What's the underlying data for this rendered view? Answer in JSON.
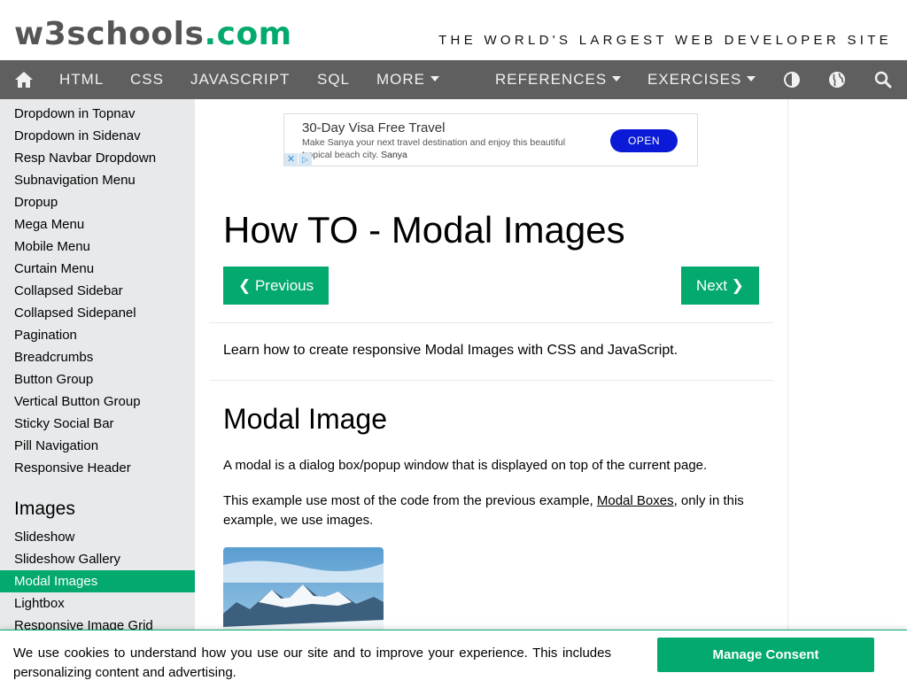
{
  "header": {
    "logo_main": "w3schools",
    "logo_suffix": ".com",
    "slogan": "THE WORLD'S LARGEST WEB DEVELOPER SITE"
  },
  "nav": {
    "items": [
      "HTML",
      "CSS",
      "JAVASCRIPT",
      "SQL",
      "MORE",
      "REFERENCES",
      "EXERCISES"
    ],
    "icons": [
      "home-icon",
      "contrast-icon",
      "globe-icon",
      "search-icon"
    ]
  },
  "sidebar": {
    "links": [
      "Dropdown in Topnav",
      "Dropdown in Sidenav",
      "Resp Navbar Dropdown",
      "Subnavigation Menu",
      "Dropup",
      "Mega Menu",
      "Mobile Menu",
      "Curtain Menu",
      "Collapsed Sidebar",
      "Collapsed Sidepanel",
      "Pagination",
      "Breadcrumbs",
      "Button Group",
      "Vertical Button Group",
      "Sticky Social Bar",
      "Pill Navigation",
      "Responsive Header"
    ],
    "images_heading": "Images",
    "image_links": [
      "Slideshow",
      "Slideshow Gallery",
      "Modal Images",
      "Lightbox",
      "Responsive Image Grid"
    ],
    "active_link": "Modal Images"
  },
  "ad": {
    "title": "30-Day Visa Free Travel",
    "text": "Make Sanya your next travel destination and enjoy this beautiful tropical beach city.",
    "brand": "Sanya",
    "button": "OPEN"
  },
  "main": {
    "title": "How TO - Modal Images",
    "prev_button": "❮ Previous",
    "next_button": "Next ❯",
    "intro": "Learn how to create responsive Modal Images with CSS and JavaScript.",
    "section_heading": "Modal Image",
    "para1": "A modal is a dialog box/popup window that is displayed on top of the current page.",
    "para2_before": "This example use most of the code from the previous example, ",
    "para2_link": "Modal Boxes",
    "para2_after": ", only in this example, we use images."
  },
  "cookie": {
    "text": "We use cookies to understand how you use our site and to improve your experience. This includes personalizing content and advertising.",
    "button": "Manage Consent"
  },
  "colors": {
    "brand_green": "#04AA6D",
    "nav_bg": "#5f5f5f",
    "sidebar_bg": "#e7e9eb"
  }
}
